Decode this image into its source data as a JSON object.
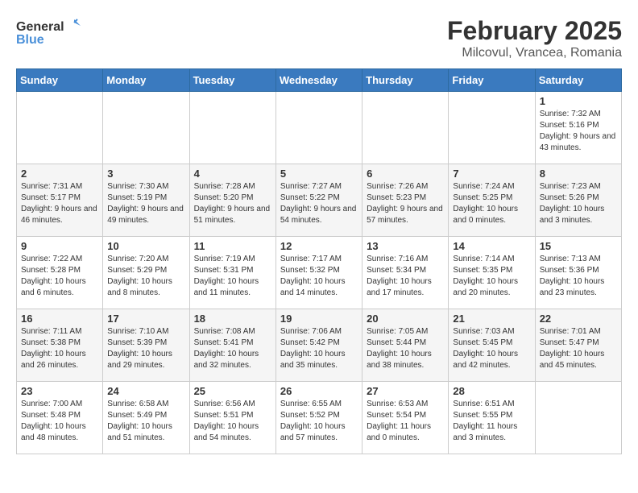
{
  "header": {
    "logo_general": "General",
    "logo_blue": "Blue",
    "title": "February 2025",
    "subtitle": "Milcovul, Vrancea, Romania"
  },
  "weekdays": [
    "Sunday",
    "Monday",
    "Tuesday",
    "Wednesday",
    "Thursday",
    "Friday",
    "Saturday"
  ],
  "weeks": [
    [
      {
        "day": "",
        "info": ""
      },
      {
        "day": "",
        "info": ""
      },
      {
        "day": "",
        "info": ""
      },
      {
        "day": "",
        "info": ""
      },
      {
        "day": "",
        "info": ""
      },
      {
        "day": "",
        "info": ""
      },
      {
        "day": "1",
        "info": "Sunrise: 7:32 AM\nSunset: 5:16 PM\nDaylight: 9 hours and 43 minutes."
      }
    ],
    [
      {
        "day": "2",
        "info": "Sunrise: 7:31 AM\nSunset: 5:17 PM\nDaylight: 9 hours and 46 minutes."
      },
      {
        "day": "3",
        "info": "Sunrise: 7:30 AM\nSunset: 5:19 PM\nDaylight: 9 hours and 49 minutes."
      },
      {
        "day": "4",
        "info": "Sunrise: 7:28 AM\nSunset: 5:20 PM\nDaylight: 9 hours and 51 minutes."
      },
      {
        "day": "5",
        "info": "Sunrise: 7:27 AM\nSunset: 5:22 PM\nDaylight: 9 hours and 54 minutes."
      },
      {
        "day": "6",
        "info": "Sunrise: 7:26 AM\nSunset: 5:23 PM\nDaylight: 9 hours and 57 minutes."
      },
      {
        "day": "7",
        "info": "Sunrise: 7:24 AM\nSunset: 5:25 PM\nDaylight: 10 hours and 0 minutes."
      },
      {
        "day": "8",
        "info": "Sunrise: 7:23 AM\nSunset: 5:26 PM\nDaylight: 10 hours and 3 minutes."
      }
    ],
    [
      {
        "day": "9",
        "info": "Sunrise: 7:22 AM\nSunset: 5:28 PM\nDaylight: 10 hours and 6 minutes."
      },
      {
        "day": "10",
        "info": "Sunrise: 7:20 AM\nSunset: 5:29 PM\nDaylight: 10 hours and 8 minutes."
      },
      {
        "day": "11",
        "info": "Sunrise: 7:19 AM\nSunset: 5:31 PM\nDaylight: 10 hours and 11 minutes."
      },
      {
        "day": "12",
        "info": "Sunrise: 7:17 AM\nSunset: 5:32 PM\nDaylight: 10 hours and 14 minutes."
      },
      {
        "day": "13",
        "info": "Sunrise: 7:16 AM\nSunset: 5:34 PM\nDaylight: 10 hours and 17 minutes."
      },
      {
        "day": "14",
        "info": "Sunrise: 7:14 AM\nSunset: 5:35 PM\nDaylight: 10 hours and 20 minutes."
      },
      {
        "day": "15",
        "info": "Sunrise: 7:13 AM\nSunset: 5:36 PM\nDaylight: 10 hours and 23 minutes."
      }
    ],
    [
      {
        "day": "16",
        "info": "Sunrise: 7:11 AM\nSunset: 5:38 PM\nDaylight: 10 hours and 26 minutes."
      },
      {
        "day": "17",
        "info": "Sunrise: 7:10 AM\nSunset: 5:39 PM\nDaylight: 10 hours and 29 minutes."
      },
      {
        "day": "18",
        "info": "Sunrise: 7:08 AM\nSunset: 5:41 PM\nDaylight: 10 hours and 32 minutes."
      },
      {
        "day": "19",
        "info": "Sunrise: 7:06 AM\nSunset: 5:42 PM\nDaylight: 10 hours and 35 minutes."
      },
      {
        "day": "20",
        "info": "Sunrise: 7:05 AM\nSunset: 5:44 PM\nDaylight: 10 hours and 38 minutes."
      },
      {
        "day": "21",
        "info": "Sunrise: 7:03 AM\nSunset: 5:45 PM\nDaylight: 10 hours and 42 minutes."
      },
      {
        "day": "22",
        "info": "Sunrise: 7:01 AM\nSunset: 5:47 PM\nDaylight: 10 hours and 45 minutes."
      }
    ],
    [
      {
        "day": "23",
        "info": "Sunrise: 7:00 AM\nSunset: 5:48 PM\nDaylight: 10 hours and 48 minutes."
      },
      {
        "day": "24",
        "info": "Sunrise: 6:58 AM\nSunset: 5:49 PM\nDaylight: 10 hours and 51 minutes."
      },
      {
        "day": "25",
        "info": "Sunrise: 6:56 AM\nSunset: 5:51 PM\nDaylight: 10 hours and 54 minutes."
      },
      {
        "day": "26",
        "info": "Sunrise: 6:55 AM\nSunset: 5:52 PM\nDaylight: 10 hours and 57 minutes."
      },
      {
        "day": "27",
        "info": "Sunrise: 6:53 AM\nSunset: 5:54 PM\nDaylight: 11 hours and 0 minutes."
      },
      {
        "day": "28",
        "info": "Sunrise: 6:51 AM\nSunset: 5:55 PM\nDaylight: 11 hours and 3 minutes."
      },
      {
        "day": "",
        "info": ""
      }
    ]
  ]
}
